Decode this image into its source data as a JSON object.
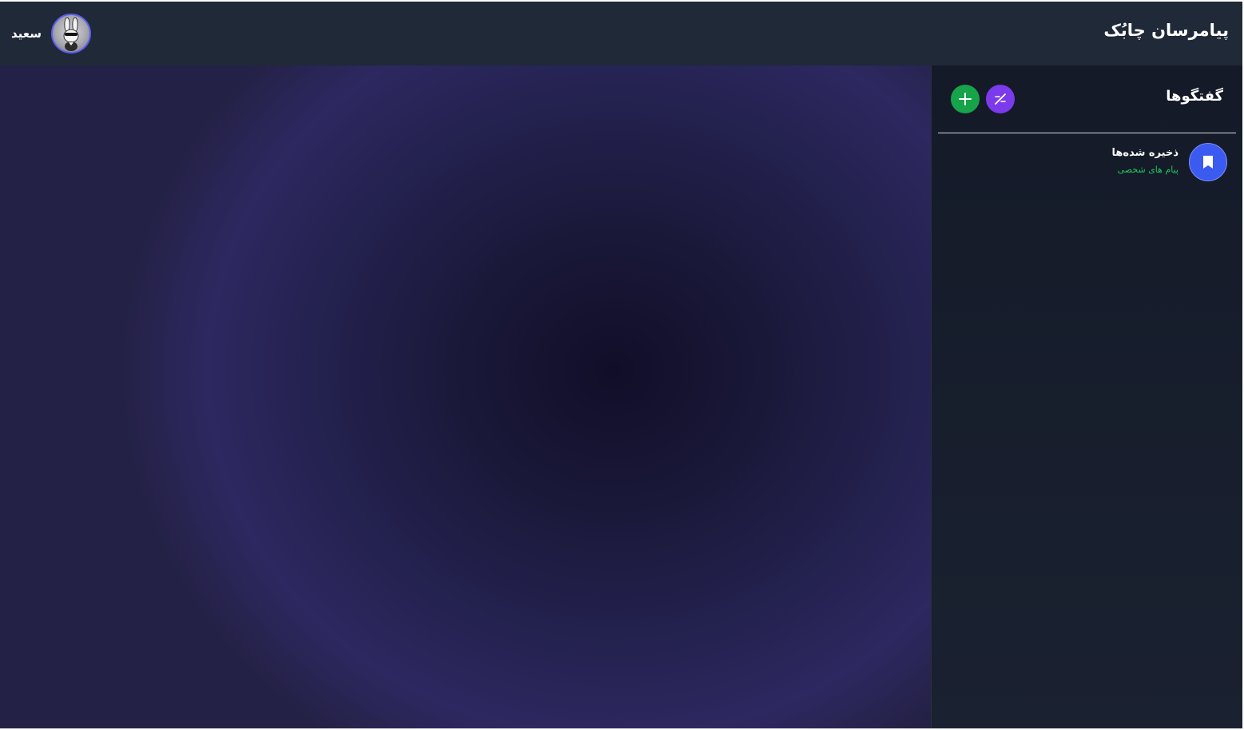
{
  "header": {
    "app_title": "پیامرسان چابُک",
    "user": {
      "name": "سعید",
      "avatar_icon": "rabbit-avatar-icon"
    }
  },
  "sidebar": {
    "title": "گفتگوها",
    "buttons": [
      {
        "icon": "plus-icon",
        "color": "#16a34a"
      },
      {
        "icon": "phone-dialpad-icon",
        "color": "#7c3aed"
      }
    ],
    "conversations": [
      {
        "name": "ذخیره شده‌ها",
        "subtitle": "پیام های شخصی",
        "icon": "bookmark-icon",
        "avatar_color": "#3b5bf0"
      }
    ]
  },
  "colors": {
    "header_bg": "#1f2938",
    "sidebar_bg": "#141a28",
    "accent_green": "#22c55e",
    "chat_bg_center": "#100e28",
    "chat_bg_edge": "#2d2860"
  }
}
